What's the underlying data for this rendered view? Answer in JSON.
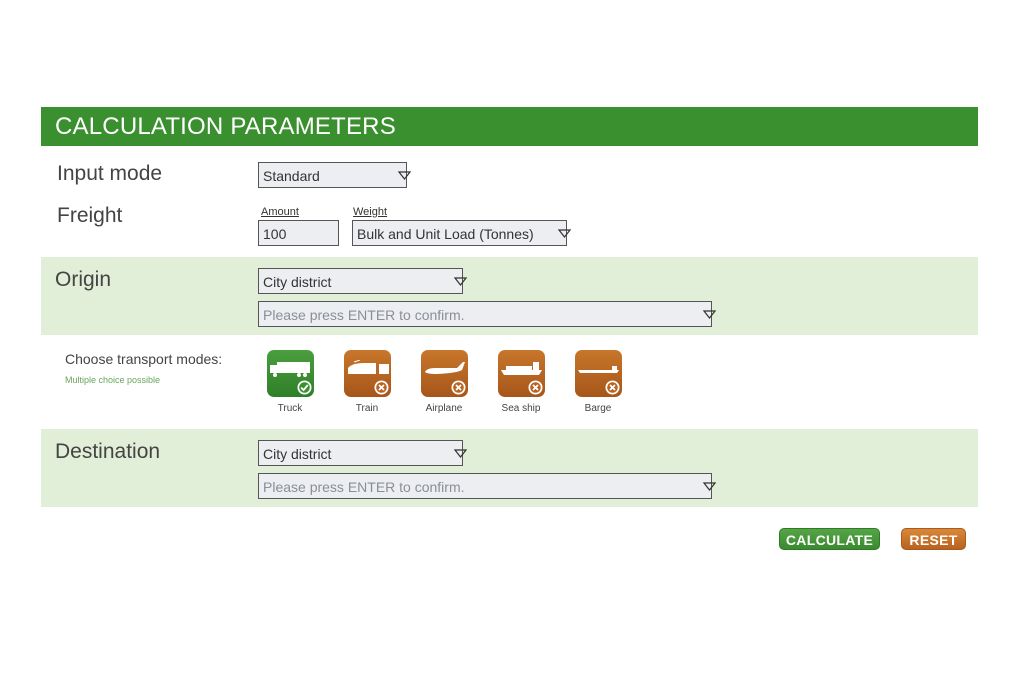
{
  "header": {
    "title": "CALCULATION PARAMETERS"
  },
  "input_mode": {
    "label": "Input mode",
    "value": "Standard"
  },
  "freight": {
    "label": "Freight",
    "amount_label": "Amount",
    "amount_value": "100",
    "weight_label": "Weight",
    "weight_value": "Bulk and Unit Load (Tonnes)"
  },
  "origin": {
    "label": "Origin",
    "type_value": "City district",
    "location_placeholder": "Please press ENTER to confirm."
  },
  "transport": {
    "title": "Choose transport modes:",
    "subtitle": "Multiple choice possible",
    "modes": [
      {
        "label": "Truck",
        "icon": "truck-icon",
        "selected": true
      },
      {
        "label": "Train",
        "icon": "train-icon",
        "selected": false
      },
      {
        "label": "Airplane",
        "icon": "airplane-icon",
        "selected": false
      },
      {
        "label": "Sea ship",
        "icon": "sea-ship-icon",
        "selected": false
      },
      {
        "label": "Barge",
        "icon": "barge-icon",
        "selected": false
      }
    ]
  },
  "destination": {
    "label": "Destination",
    "type_value": "City district",
    "location_placeholder": "Please press ENTER to confirm."
  },
  "actions": {
    "calculate": "CALCULATE",
    "reset": "RESET"
  },
  "colors": {
    "brand_green": "#3a8f2f",
    "band_green": "#e1eed8",
    "accent_orange": "#c06d27"
  }
}
